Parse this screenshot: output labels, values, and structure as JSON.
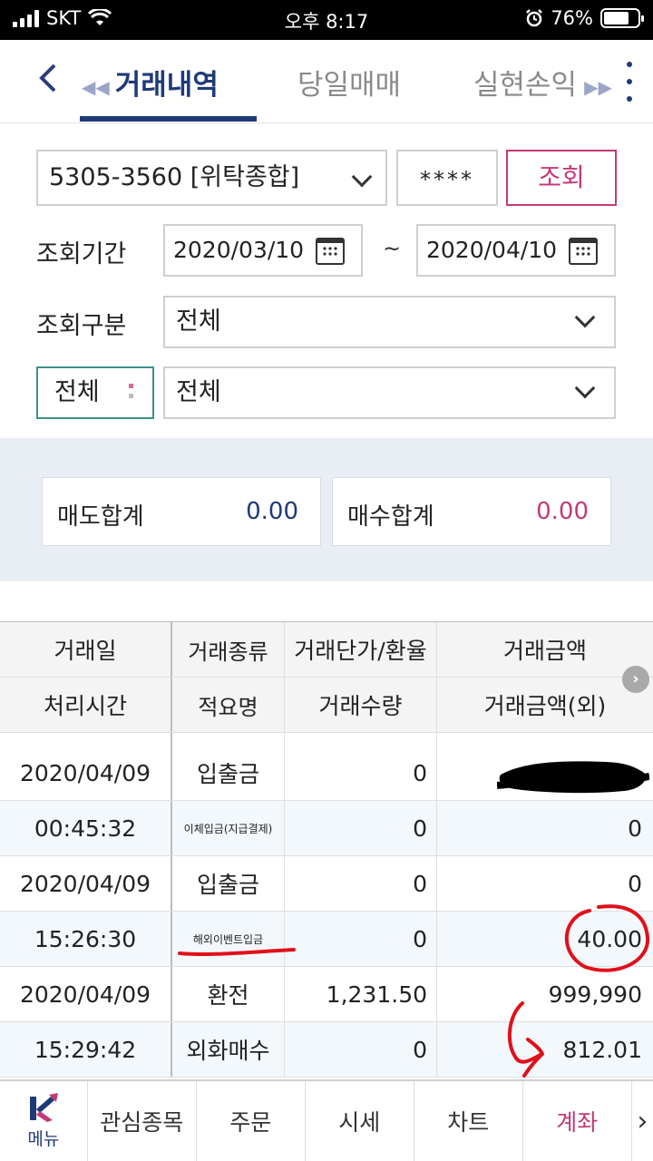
{
  "status_bar": {
    "carrier": "SKT",
    "time": "오후 8:17",
    "battery": "76%",
    "battery_level": 0.76
  },
  "header": {
    "tabs": [
      {
        "label": "거래내역",
        "active": true
      },
      {
        "label": "당일매매",
        "active": false
      },
      {
        "label": "실현손익",
        "active": false
      }
    ]
  },
  "form": {
    "account": "5305-3560 [위탁종합]",
    "password_mask": "****",
    "query_label": "조회",
    "period_label": "조회기간",
    "date_start": "2020/03/10",
    "date_separator": "~",
    "date_end": "2020/04/10",
    "type_label": "조회구분",
    "type_value": "전체",
    "filter_label": "전체",
    "detail_value": "전체"
  },
  "summary": {
    "sell_label": "매도합계",
    "sell_value": "0.00",
    "buy_label": "매수합계",
    "buy_value": "0.00"
  },
  "table": {
    "header_row1": [
      "거래일",
      "거래종류",
      "거래단가/환율",
      "거래금액"
    ],
    "header_row2": [
      "처리시간",
      "적요명",
      "거래수량",
      "거래금액(외)"
    ],
    "rows": [
      [
        "2020/04/09",
        "입출금",
        "0",
        ""
      ],
      [
        "00:45:32",
        "이체입금(지급결제)",
        "0",
        "0"
      ],
      [
        "2020/04/09",
        "입출금",
        "0",
        "0"
      ],
      [
        "15:26:30",
        "해외이벤트입금",
        "0",
        "40.00"
      ],
      [
        "2020/04/09",
        "환전",
        "1,231.50",
        "999,990"
      ],
      [
        "15:29:42",
        "외화매수",
        "0",
        "812.01"
      ]
    ]
  },
  "bottom_nav": {
    "menu_label": "메뉴",
    "items": [
      "관심종목",
      "주문",
      "시세",
      "차트",
      "계좌"
    ],
    "active": "계좌"
  },
  "colors": {
    "brand_navy": "#1f3a78",
    "accent_pink": "#c23a78",
    "annotation_red": "#e0101a"
  }
}
